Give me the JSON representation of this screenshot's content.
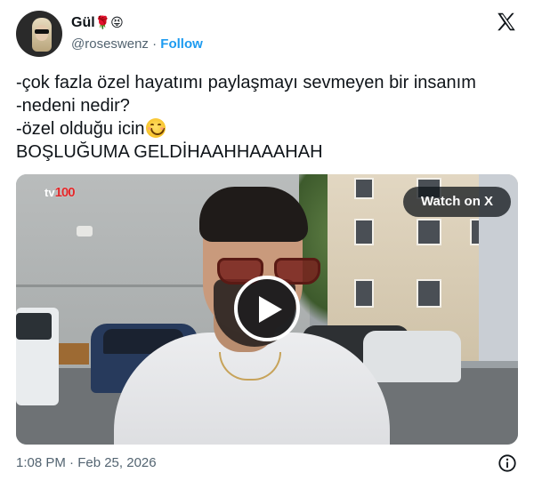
{
  "author": {
    "display_name": "Gül",
    "name_emojis": "🌹😝",
    "handle": "@roseswenz",
    "separator": "·",
    "follow_label": "Follow"
  },
  "post": {
    "lines": [
      "-çok fazla özel hayatımı paylaşmayı sevmeyen bir insanım",
      "-nedeni nedir?",
      "-özel olduğu icin",
      "BOŞLUĞUMA GELDİHAAHHAAAHAH"
    ],
    "emoji_after_line_3": "smiling-face-with-smiling-eyes"
  },
  "media": {
    "channel_logo_prefix": "tv",
    "channel_logo_number": "100",
    "watch_button_label": "Watch on X",
    "play_icon": "play-icon"
  },
  "footer": {
    "timestamp": "1:08 PM · Feb 25, 2026",
    "info_icon": "info-icon"
  },
  "colors": {
    "link_blue": "#1d9bf0",
    "secondary_text": "#536471",
    "primary_text": "#0f1419"
  }
}
